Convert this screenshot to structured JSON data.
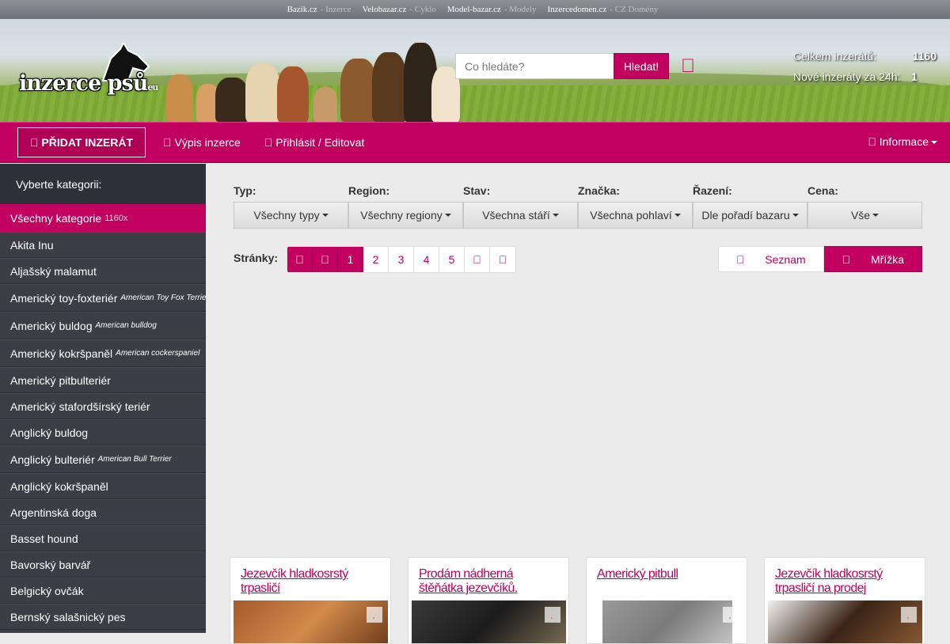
{
  "topbar": {
    "links": [
      {
        "site": "Bazik.cz",
        "sub": "- Inzerce"
      },
      {
        "site": "Velobazar.cz",
        "sub": "- Cyklo"
      },
      {
        "site": "Model-bazar.cz",
        "sub": "- Modely"
      },
      {
        "site": "Inzercedomen.cz",
        "sub": "- CZ Domény"
      }
    ]
  },
  "header": {
    "logo_text": "inzerce psů",
    "logo_suffix": "eu",
    "search_placeholder": "Co hledáte?",
    "search_button": "Hledat!",
    "chat_icon": "",
    "stats": {
      "total_label": "Celkem inzerátů:",
      "total_value": "1160",
      "new_label": "Nové inzeráty za 24h:",
      "new_value": "1"
    }
  },
  "nav": {
    "add_label": "PŘIDAT INZERÁT",
    "add_icon": "",
    "list_label": "Výpis inzerce",
    "list_icon": "",
    "login_label": "Přihlásit / Editovat",
    "login_icon": "",
    "info_label": "Informace",
    "info_icon": ""
  },
  "sidebar": {
    "heading": "Vyberte kategorii:",
    "items": [
      {
        "label": "Všechny kategorie",
        "count": "1160x",
        "active": true
      },
      {
        "label": "Akita Inu"
      },
      {
        "label": "Aljašský malamut"
      },
      {
        "label": "Americký toy-foxteriér",
        "sub": "American Toy Fox Terrier"
      },
      {
        "label": "Americký buldog",
        "sub": "American bulldog"
      },
      {
        "label": "Americký kokršpaněl",
        "sub": "American cockerspaniel"
      },
      {
        "label": "Americký pitbulteriér"
      },
      {
        "label": "Americký stafordšírský teriér"
      },
      {
        "label": "Anglický buldog"
      },
      {
        "label": "Anglický bulteriér",
        "sub": "American Bull Terrier"
      },
      {
        "label": "Anglický kokršpaněl"
      },
      {
        "label": "Argentinská doga"
      },
      {
        "label": "Basset hound"
      },
      {
        "label": "Bavorský barvář"
      },
      {
        "label": "Belgický ovčák"
      },
      {
        "label": "Bernský salašnický pes"
      }
    ]
  },
  "filters": [
    {
      "label": "Typ:",
      "value": "Všechny typy"
    },
    {
      "label": "Region:",
      "value": "Všechny regiony"
    },
    {
      "label": "Stav:",
      "value": "Všechna stáří"
    },
    {
      "label": "Značka:",
      "value": "Všechna pohlaví"
    },
    {
      "label": "Řazení:",
      "value": "Dle pořadí bazaru"
    },
    {
      "label": "Cena:",
      "value": "Vše"
    }
  ],
  "pagination": {
    "label": "Stránky:",
    "first_icon": "",
    "prev_icon": "",
    "pages": [
      "1",
      "2",
      "3",
      "4",
      "5"
    ],
    "current": "1",
    "next_icon": "",
    "last_icon": ""
  },
  "view_toggle": {
    "list_label": "Seznam",
    "list_icon": "",
    "grid_label": "Mřížka",
    "grid_icon": ""
  },
  "cards": [
    {
      "title": "Jezevčík hladkosrstý trpasličí",
      "fav_icon": "",
      "photo_colors": [
        "#a45a2a",
        "#d28a4c",
        "#6b3a18"
      ]
    },
    {
      "title": "Prodám nádherná štěňátka jezevčíků.",
      "fav_icon": "",
      "photo_colors": [
        "#3a3a3a",
        "#1c1c1c",
        "#7a6c52"
      ]
    },
    {
      "title": "Americký pitbull",
      "fav_icon": "",
      "photo_colors": [
        "#9a9a9a",
        "#7b7b7b",
        "#c8c8c8"
      ]
    },
    {
      "title": "Jezevčík hladkosrstý trpasličí na prodej",
      "fav_icon": "",
      "photo_colors": [
        "#f2f2f2",
        "#3b2416",
        "#8a5a34"
      ]
    }
  ]
}
